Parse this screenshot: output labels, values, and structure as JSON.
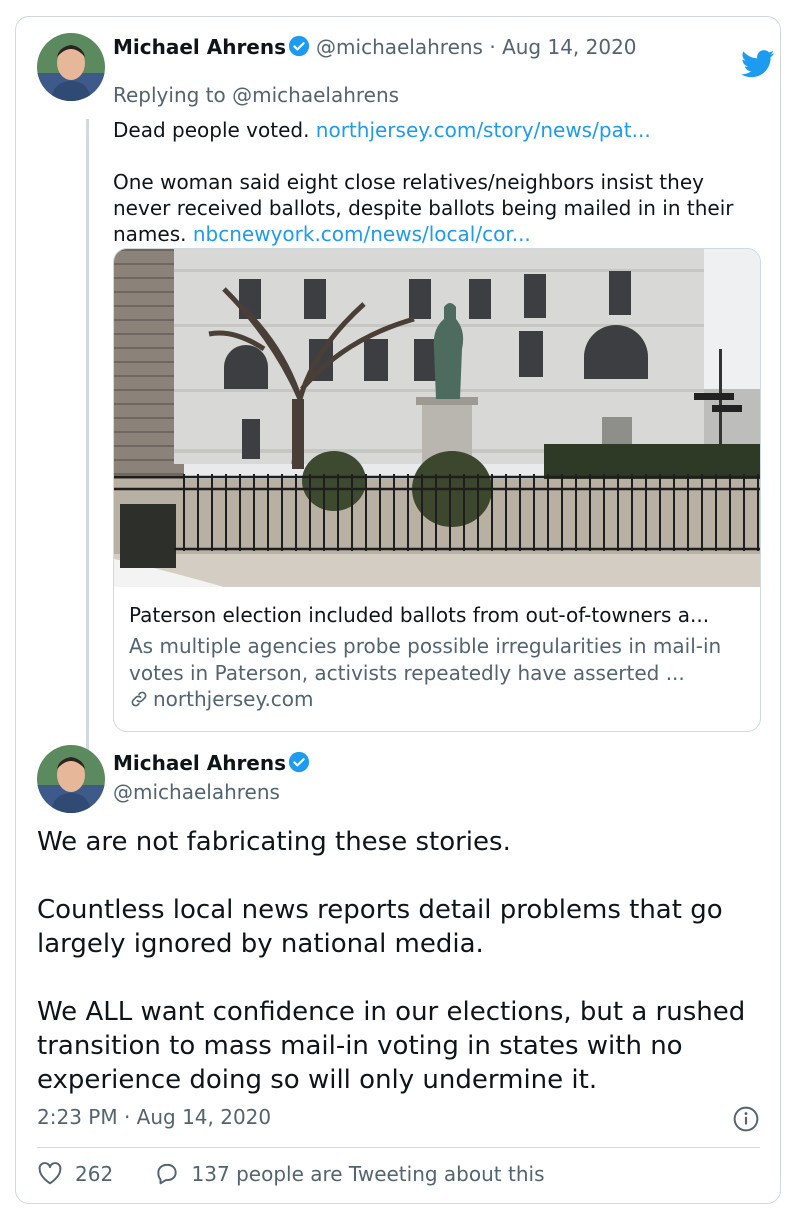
{
  "tweet1": {
    "author_name": "Michael Ahrens",
    "author_handle": "@michaelahrens",
    "separator": "·",
    "date": "Aug 14, 2020",
    "replying_to": "Replying to @michaelahrens",
    "para1_text": "Dead people voted.",
    "para1_link": "northjersey.com/story/news/pat...",
    "para2_text": "One woman said eight close relatives/neighbors insist they never received ballots, despite ballots being mailed in in their names.",
    "para2_link": "nbcnewyork.com/news/local/cor...",
    "link_card": {
      "title": "Paterson election included ballots from out-of-towners a...",
      "description": "As multiple agencies probe possible irregularities in mail-in votes in Paterson, activists repeatedly have asserted ...",
      "domain": "northjersey.com"
    }
  },
  "tweet2": {
    "author_name": "Michael Ahrens",
    "author_handle": "@michaelahrens",
    "paragraphs": [
      "We are not fabricating these stories.",
      "Countless local news reports detail problems that go largely ignored by national media.",
      "We ALL want confidence in our elections, but a rushed transition to mass mail-in voting in states with no experience doing so will only undermine it."
    ],
    "timestamp": "2:23 PM · Aug 14, 2020",
    "likes": "262",
    "tweeting": "137 people are Tweeting about this"
  },
  "icons": {
    "brand": "twitter-bird-icon",
    "verified": "verified-badge-icon",
    "link": "link-icon",
    "info": "info-icon",
    "like": "heart-icon",
    "reply": "speech-bubble-icon"
  },
  "colors": {
    "brand_blue": "#1d9bf0",
    "text": "#0f1419",
    "secondary_text": "#536471",
    "border": "#cfd9de"
  }
}
